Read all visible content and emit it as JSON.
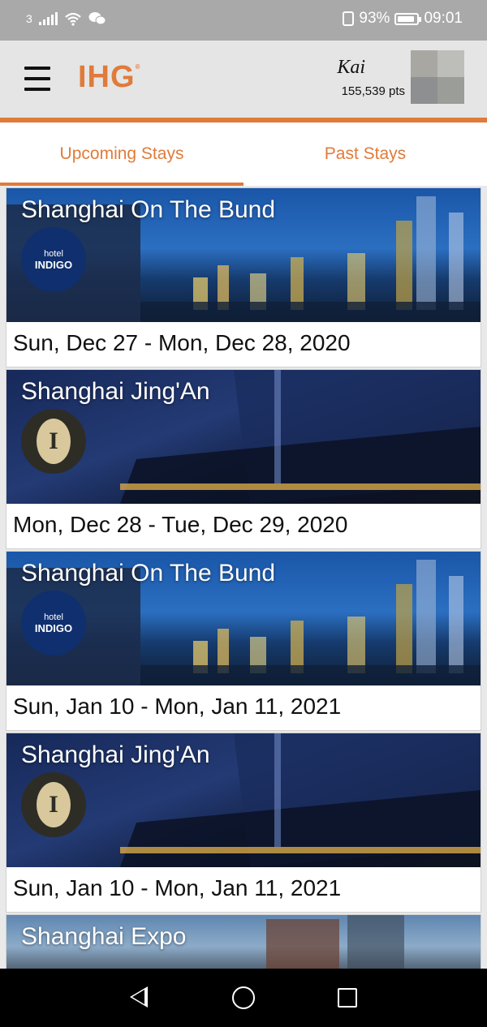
{
  "status_bar": {
    "sim": "3",
    "battery": "93%",
    "time": "09:01"
  },
  "header": {
    "logo": "IHG",
    "logo_mark": "®",
    "user_name": "Kai",
    "points": "155,539 pts"
  },
  "tabs": [
    {
      "label": "Upcoming Stays",
      "active": true
    },
    {
      "label": "Past Stays",
      "active": false
    }
  ],
  "stays": [
    {
      "hotel": "Shanghai On The Bund",
      "brand": "hotel INDIGO",
      "brand_top": "hotel",
      "brand_bottom": "INDIGO",
      "dates": "Sun, Dec 27 - Mon, Dec 28, 2020"
    },
    {
      "hotel": "Shanghai Jing'An",
      "brand": "InterContinental",
      "brand_seal": "I",
      "dates": "Mon, Dec 28 - Tue, Dec 29, 2020"
    },
    {
      "hotel": "Shanghai On The Bund",
      "brand": "hotel INDIGO",
      "brand_top": "hotel",
      "brand_bottom": "INDIGO",
      "dates": "Sun, Jan 10 - Mon, Jan 11, 2021"
    },
    {
      "hotel": "Shanghai Jing'An",
      "brand": "InterContinental",
      "brand_seal": "I",
      "dates": "Sun, Jan 10 - Mon, Jan 11, 2021"
    },
    {
      "hotel": "Shanghai Expo"
    }
  ],
  "colors": {
    "accent": "#e07b3a",
    "status_bar": "#a9a9a9",
    "nav_bar": "#000000"
  },
  "icons": {
    "menu": "hamburger-icon",
    "back": "back-icon",
    "home": "home-icon",
    "recents": "recents-icon"
  }
}
